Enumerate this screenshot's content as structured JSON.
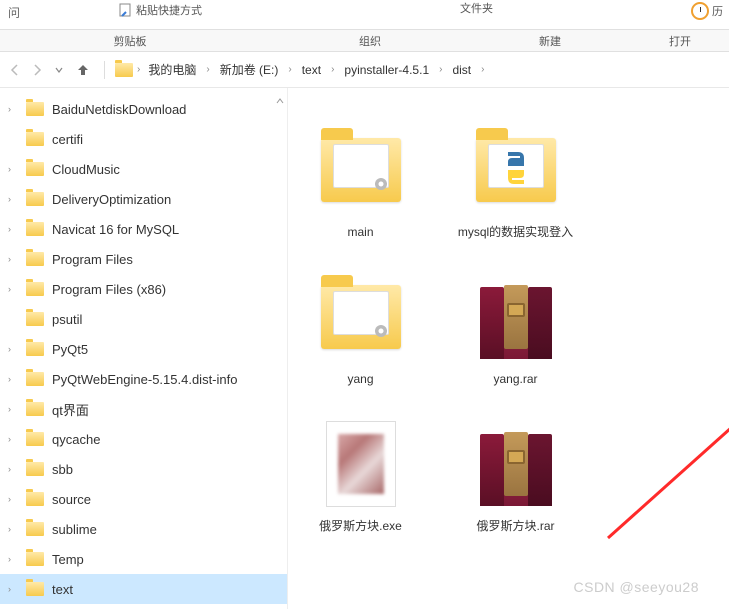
{
  "ribbon_top": {
    "title_cut": "问",
    "paste_hint": "粘贴快捷方式",
    "folder_label": "文件夹",
    "history_label": "历"
  },
  "ribbon_groups": {
    "clipboard": "剪贴板",
    "organize": "组织",
    "new": "新建",
    "open": "打开"
  },
  "breadcrumb": [
    "我的电脑",
    "新加卷 (E:)",
    "text",
    "pyinstaller-4.5.1",
    "dist"
  ],
  "tree": [
    {
      "label": "BaiduNetdiskDownload",
      "expandable": true
    },
    {
      "label": "certifi",
      "expandable": false
    },
    {
      "label": "CloudMusic",
      "expandable": true
    },
    {
      "label": "DeliveryOptimization",
      "expandable": true
    },
    {
      "label": "Navicat 16 for MySQL",
      "expandable": true
    },
    {
      "label": "Program Files",
      "expandable": true
    },
    {
      "label": "Program Files (x86)",
      "expandable": true
    },
    {
      "label": "psutil",
      "expandable": false
    },
    {
      "label": "PyQt5",
      "expandable": true
    },
    {
      "label": "PyQtWebEngine-5.15.4.dist-info",
      "expandable": true
    },
    {
      "label": "qt界面",
      "expandable": true
    },
    {
      "label": "qycache",
      "expandable": true
    },
    {
      "label": "sbb",
      "expandable": true
    },
    {
      "label": "source",
      "expandable": true
    },
    {
      "label": "sublime",
      "expandable": true
    },
    {
      "label": "Temp",
      "expandable": true
    },
    {
      "label": "text",
      "expandable": true,
      "selected": true
    }
  ],
  "files": [
    {
      "name": "main",
      "type": "folder-gear"
    },
    {
      "name": "mysql的数据实现登入",
      "type": "folder-py"
    },
    {
      "name": "yang",
      "type": "folder-gear"
    },
    {
      "name": "yang.rar",
      "type": "rar"
    },
    {
      "name": "俄罗斯方块.exe",
      "type": "exe",
      "highlighted": true
    },
    {
      "name": "俄罗斯方块.rar",
      "type": "rar"
    }
  ],
  "watermark": "CSDN @seeyou28"
}
